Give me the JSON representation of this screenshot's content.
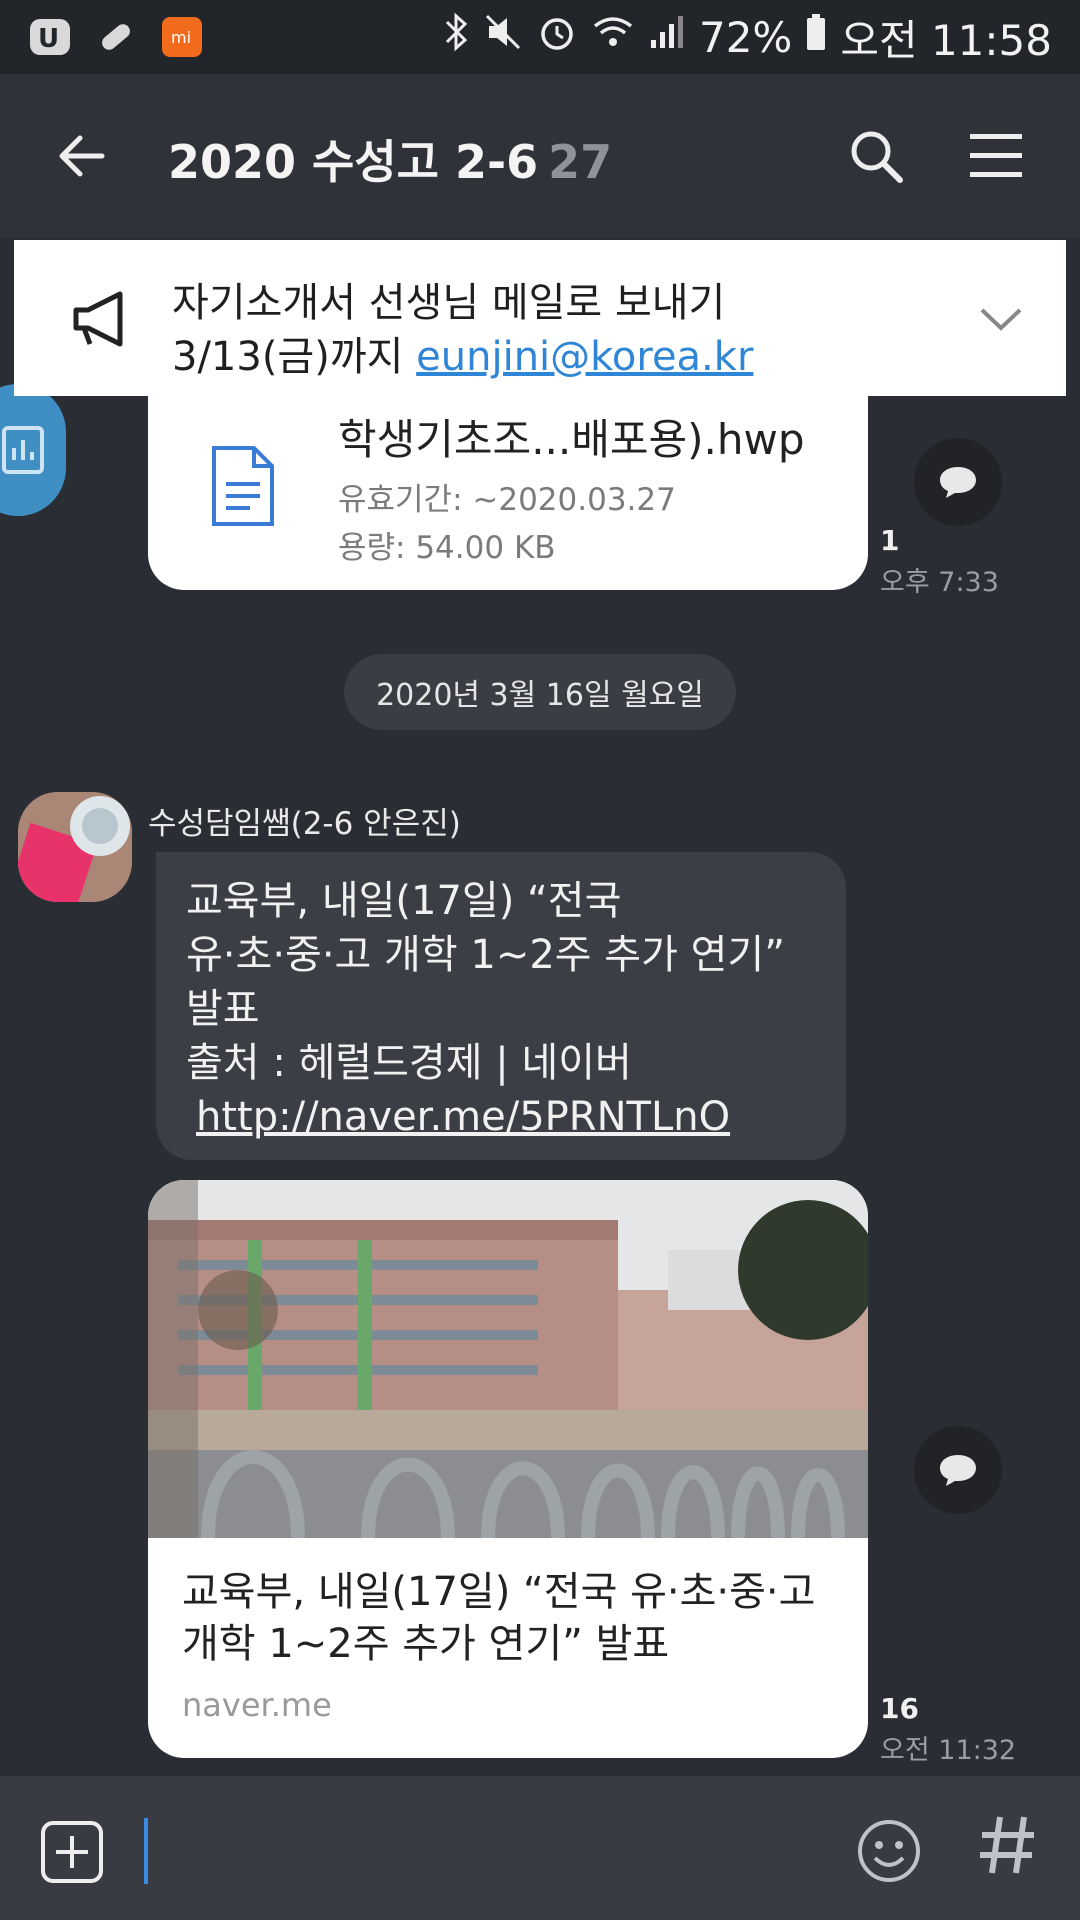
{
  "status_bar": {
    "battery": "72%",
    "time": "오전 11:58"
  },
  "header": {
    "title": "2020 수성고 2-6",
    "member_count": "27"
  },
  "notice": {
    "line1": "자기소개서 선생님 메일로 보내기",
    "line2_prefix": "3/13(금)까지 ",
    "email": "eunjini@korea.kr"
  },
  "file_message": {
    "file_name": "학생기초조...배포용).hwp",
    "expiry": "유효기간: ~2020.03.27",
    "size": "용량: 54.00 KB",
    "unread": "1",
    "time": "오후 7:33"
  },
  "date_divider": "2020년 3월 16일 월요일",
  "sender_name": "수성담임쌤(2-6 안은진)",
  "text_message": {
    "lines": [
      "교육부, 내일(17일) “전국",
      "유·초·중·고 개학 1~2주 추가 연기”",
      "발표",
      "출처 : 헤럴드경제 | 네이버"
    ],
    "link": "http://naver.me/5PRNTLnO"
  },
  "link_preview": {
    "title_lines": [
      "교육부, 내일(17일) “전국 유·초·중·고",
      "개학 1~2주 추가 연기” 발표"
    ],
    "domain": "naver.me",
    "unread": "16",
    "time": "오전 11:32"
  },
  "input": {
    "value": ""
  },
  "colors": {
    "background": "#2a2d33",
    "accent_link": "#2f86d6",
    "bubble_dark": "#3b3e44"
  }
}
